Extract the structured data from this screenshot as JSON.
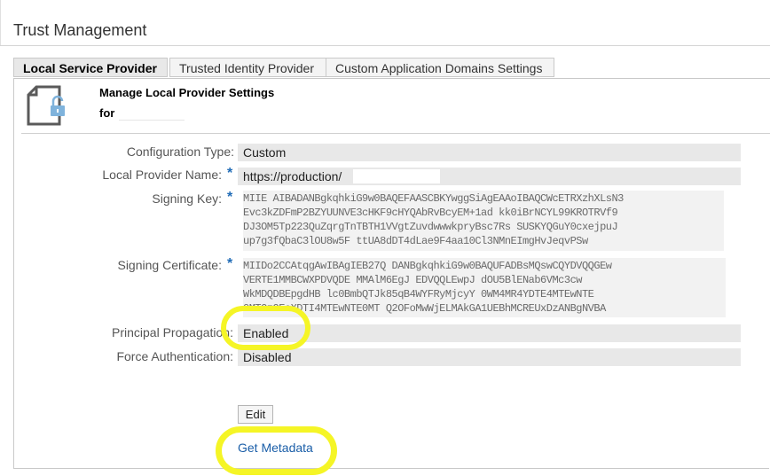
{
  "page": {
    "title": "Trust Management"
  },
  "tabs": [
    {
      "label": "Local Service Provider",
      "active": true
    },
    {
      "label": "Trusted Identity Provider",
      "active": false
    },
    {
      "label": "Custom Application Domains Settings",
      "active": false
    }
  ],
  "header": {
    "icon": "lock-document-icon",
    "title": "Manage Local Provider Settings",
    "for_prefix": "for"
  },
  "form": {
    "configuration_type": {
      "label": "Configuration Type:",
      "value": "Custom"
    },
    "local_provider_name": {
      "label": "Local Provider Name:",
      "value": "https://production/"
    },
    "signing_key": {
      "label": "Signing Key:",
      "lines": [
        "MIIE  AIBADANBgkqhkiG9w0BAQEFAASCBKYwggSiAgEAAoIBAQCWcETRXzhXLsN3",
        "Evc3kZDFmP2BZYUUNVE3cHKF9cHYQAbRvBcyEM+1ad    kk0iBrNCYL99KROTRVf9",
        "DJ3OM5Tp223QuZqrgTnTBTH1VVgtZuvdwwwkpryBsc7Rs    SUSKYQGuY0cxejpuJ",
        "up7g3fQbaC3lOU8w5F       ttUA8dDT4dLae9F4aa10Cl3NMnEImgHvJeqvPSw"
      ]
    },
    "signing_certificate": {
      "label": "Signing Certificate:",
      "lines": [
        "MIIDo2CCAtqgAwIBAgIEB27Q  DANBgkqhkiG9w0BAQUFADBsMQswCQYDVQQGEw",
        "VERTE1MMBCWXPDVQDE     MMAlM6EgJ  EDVQQLEwpJ        dOU5BlENab6VMc3cw",
        "WkMDQDBEpgdHB          lc0BmbQTJk85qB4WYFRyMjcyY       0WM4MR4YDTE4MTEwNTE",
        "0MTOzOEoXDTI4MTEwNTE0MT     Q2OFoMwWjELMAkGA1UEBhMCREUxDzANBgNVBA"
      ]
    },
    "principal_propagation": {
      "label": "Principal Propagation:",
      "value": "Enabled"
    },
    "force_authentication": {
      "label": "Force Authentication:",
      "value": "Disabled"
    },
    "required_marker": "*"
  },
  "actions": {
    "edit_label": "Edit",
    "metadata_link": "Get Metadata"
  },
  "colors": {
    "highlight": "#f5f526",
    "link": "#1a5ea8",
    "required": "#1f6bb6"
  }
}
